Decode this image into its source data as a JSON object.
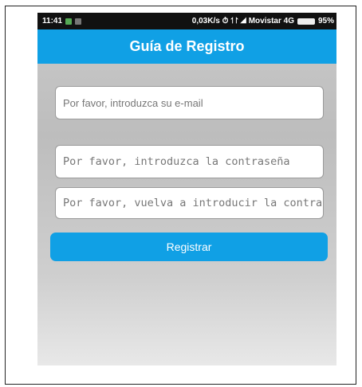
{
  "status_bar": {
    "time": "11:41",
    "right_text": "0,03K/s ⏱ ↿↾ ◢ Movistar 4G",
    "battery": "95%"
  },
  "header": {
    "title": "Guía de Registro"
  },
  "form": {
    "email_placeholder": "Por favor, introduzca su e-mail",
    "password_placeholder": "Por favor, introduzca la contraseña",
    "confirm_placeholder": "Por favor, vuelva a introducir la contraseña",
    "submit_label": "Registrar"
  },
  "colors": {
    "accent": "#10a0e5",
    "status_bar": "#111111"
  }
}
